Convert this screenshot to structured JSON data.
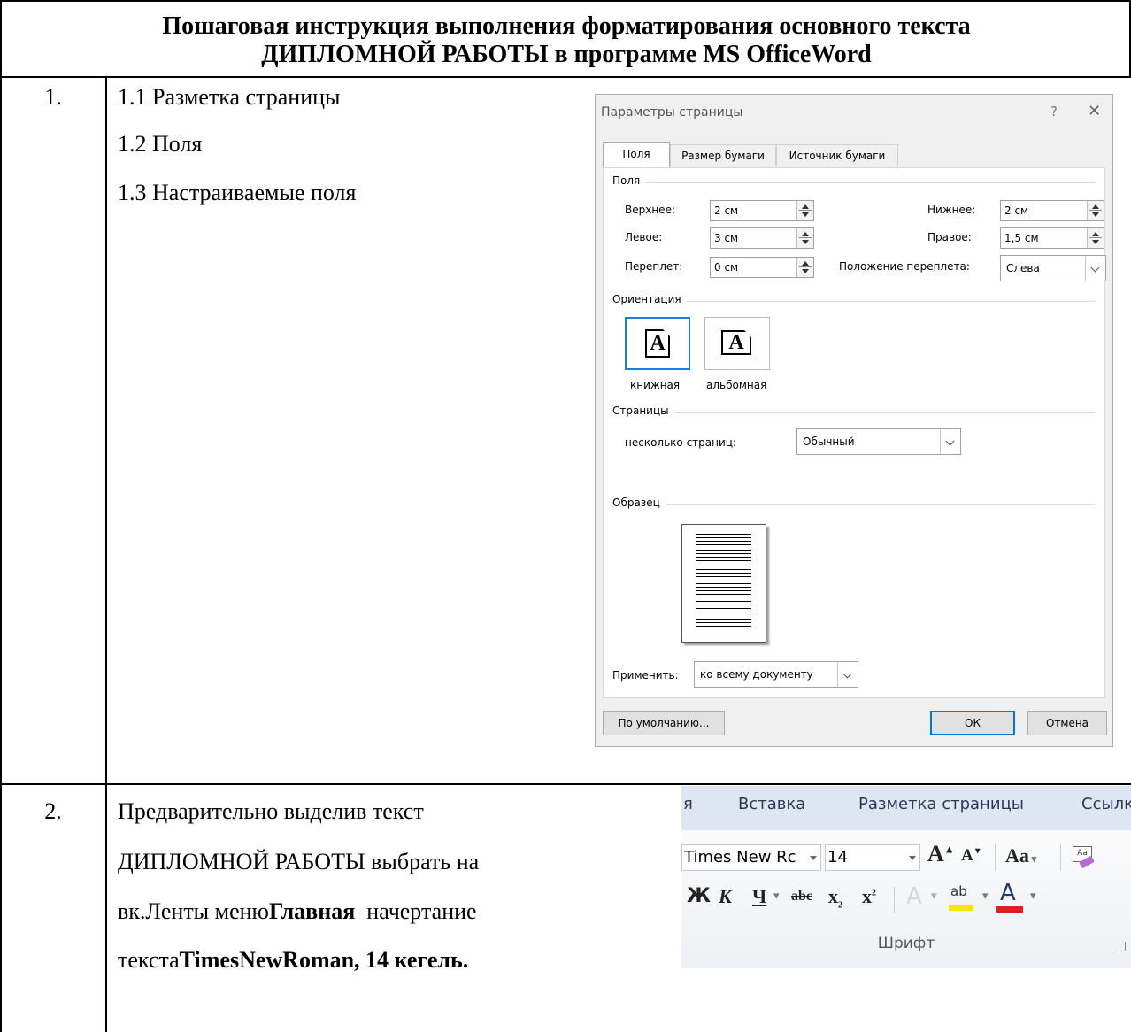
{
  "document": {
    "title_line1": "Пошаговая инструкция выполнения форматирования основного текста",
    "title_line2": "ДИПЛОМНОЙ РАБОТЫ в программе MS OfficeWord",
    "rows": [
      {
        "num": "1.",
        "lines": [
          "1.1 Разметка страницы",
          "1.2 Поля",
          "1.3 Настраиваемые поля"
        ]
      },
      {
        "num": "2.",
        "line1": "Предварительно выделив текст",
        "line2": "ДИПЛОМНОЙ РАБОТЫ выбрать на",
        "line3_a": "вк.Ленты меню",
        "line3_b": "Главная",
        "line3_c": "  начертание",
        "line4_a": "текста",
        "line4_b": "TimesNewRoman, 14 кегель."
      }
    ]
  },
  "dialog": {
    "title": "Параметры страницы",
    "help": "?",
    "close": "✕",
    "tabs": [
      "Поля",
      "Размер бумаги",
      "Источник бумаги"
    ],
    "margins_group": "Поля",
    "top_label": "Верхнее:",
    "top_value": "2 см",
    "bottom_label": "Нижнее:",
    "bottom_value": "2 см",
    "left_label": "Левое:",
    "left_value": "3 см",
    "right_label": "Правое:",
    "right_value": "1,5 см",
    "gutter_label": "Переплет:",
    "gutter_value": "0 см",
    "gutter_pos_label": "Положение переплета:",
    "gutter_pos_value": "Слева",
    "orientation_group": "Ориентация",
    "portrait": "книжная",
    "landscape": "альбомная",
    "orient_glyph": "A",
    "pages_group": "Страницы",
    "multiple_pages_label": "несколько страниц:",
    "multiple_pages_value": "Обычный",
    "preview_group": "Образец",
    "apply_label": "Применить:",
    "apply_value": "ко всему документу",
    "default_button": "По умолчанию...",
    "ok_button": "ОК",
    "cancel_button": "Отмена"
  },
  "ribbon": {
    "tab_partial": "я",
    "tab_insert": "Вставка",
    "tab_layout": "Разметка страницы",
    "tab_refs_partial": "Ссылк",
    "font_name": "Times New Rc",
    "font_size": "14",
    "grow": "A",
    "shrink": "A",
    "change_case": "Aa",
    "bold": "Ж",
    "italic": "К",
    "underline": "Ч",
    "strike": "abc",
    "subscript": "x",
    "superscript": "x",
    "highlight": "ab",
    "font_color": "A",
    "group_label": "Шрифт",
    "highlight_color": "#f5e800",
    "font_color_bar": "#e02020"
  }
}
